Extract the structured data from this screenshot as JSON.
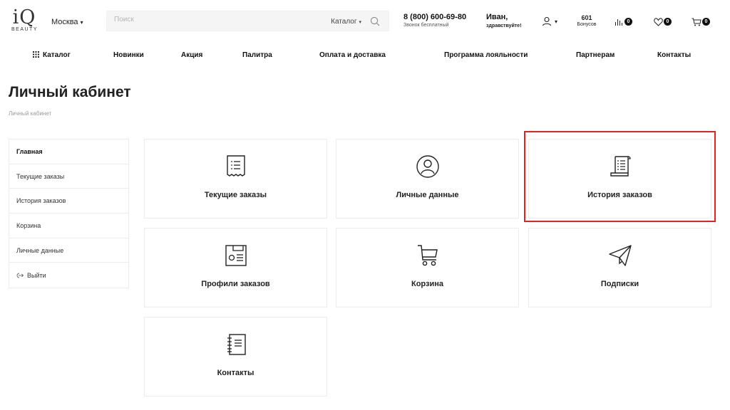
{
  "header": {
    "logo_top": "iQ",
    "logo_bottom": "BEAUTY",
    "city": "Москва",
    "search_placeholder": "Поиск",
    "search_category": "Каталог",
    "phone": "8 (800) 600-69-80",
    "phone_note": "Звонок бесплатный",
    "greeting_name": "Иван,",
    "greeting_text": "здравствуйте!",
    "bonus_count": "601",
    "bonus_label": "Бонусов",
    "compare_count": "0",
    "favorites_count": "0",
    "cart_count": "0"
  },
  "nav": {
    "items": [
      "Каталог",
      "Новинки",
      "Акция",
      "Палитра",
      "Оплата и доставка",
      "Программа лояльности",
      "Партнерам",
      "Контакты"
    ]
  },
  "page": {
    "title": "Личный кабинет",
    "breadcrumb": "Личный кабинет"
  },
  "sidebar": {
    "items": [
      "Главная",
      "Текущие заказы",
      "История заказов",
      "Корзина",
      "Личные данные",
      "Выйти"
    ],
    "active": "Главная"
  },
  "tiles": [
    {
      "label": "Текущие заказы",
      "icon": "receipt-icon"
    },
    {
      "label": "Личные данные",
      "icon": "user-circle-icon"
    },
    {
      "label": "История заказов",
      "icon": "scroll-icon"
    },
    {
      "label": "Профили заказов",
      "icon": "profile-card-icon"
    },
    {
      "label": "Корзина",
      "icon": "cart-icon"
    },
    {
      "label": "Подписки",
      "icon": "paper-plane-icon"
    },
    {
      "label": "Контакты",
      "icon": "address-book-icon"
    }
  ],
  "colors": {
    "highlight": "#e02424",
    "text": "#222222",
    "border": "#ececec"
  }
}
